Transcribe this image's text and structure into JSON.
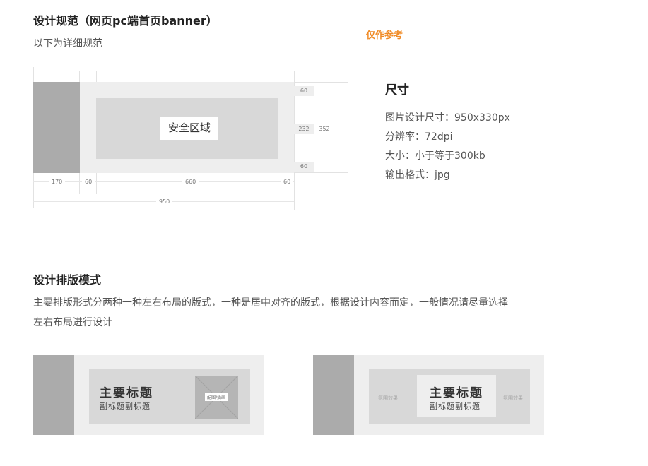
{
  "section1": {
    "title": "设计规范（网页pc端首页banner）",
    "subtitle": "以下为详细规范",
    "note": "仅作参考"
  },
  "diagram": {
    "safe_zone_label": "安全区域",
    "dim_left": "170",
    "dim_margin_left": "60",
    "dim_center": "660",
    "dim_margin_right": "60",
    "dim_total": "950",
    "dim_top": "60",
    "dim_middle": "232",
    "dim_bottom": "60",
    "dim_height": "352"
  },
  "spec": {
    "heading": "尺寸",
    "lines": [
      "图片设计尺寸：950x330px",
      "分辨率：72dpi",
      "大小：小于等于300kb",
      "输出格式：jpg"
    ]
  },
  "section2": {
    "title": "设计排版模式",
    "desc_line1": "主要排版形式分两种一种左右布局的版式，一种是居中对齐的版式，根据设计内容而定，一般情况请尽量选择",
    "desc_line2": "左右布局进行设计"
  },
  "example_left": {
    "main_title": "主要标题",
    "sub_title": "副标题副标题",
    "image_label": "配图/插画"
  },
  "example_center": {
    "main_title": "主要标题",
    "sub_title": "副标题副标题",
    "left_label": "氛围效果",
    "right_label": "氛围效果"
  },
  "colors": {
    "accent_note": "#f08a24",
    "dark_block": "#ababab",
    "light_block": "#eeeeee",
    "safe_zone": "#d8d8d8"
  }
}
